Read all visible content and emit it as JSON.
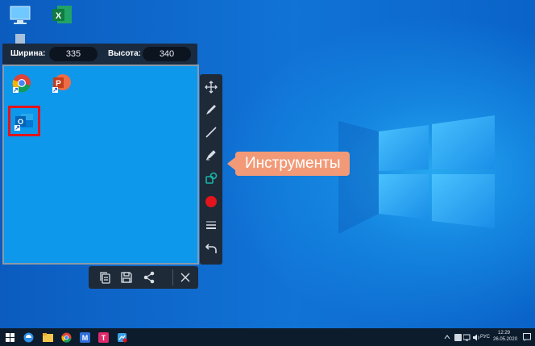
{
  "size_bar": {
    "width_label": "Ширина:",
    "width_value": "335",
    "height_label": "Высота:",
    "height_value": "340"
  },
  "callout": {
    "text": "Инструменты"
  },
  "desktop_icons": [
    "this-pc-icon",
    "excel-icon",
    "recycle-bin-icon",
    "chrome-icon",
    "powerpoint-icon",
    "outlook-icon"
  ],
  "vertical_tools": [
    "move-icon",
    "pen-icon",
    "line-icon",
    "marker-icon",
    "shape-icon",
    "color-dot-icon",
    "line-width-icon",
    "undo-icon"
  ],
  "horizontal_tools": [
    "copy-icon",
    "save-icon",
    "share-icon",
    "close-icon"
  ],
  "taskbar": {
    "language": "РУС",
    "time": "12:29",
    "date": "26.05.2020"
  },
  "colors": {
    "selected_tool": "#18b4a8",
    "selected_color": "#e3141c",
    "callout": "#f29a78",
    "highlight_box": "#e3141c"
  }
}
